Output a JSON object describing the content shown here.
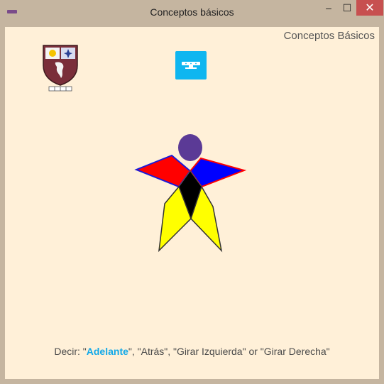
{
  "window": {
    "title": "Conceptos básicos",
    "minimize_glyph": "–",
    "maximize_glyph": "☐",
    "close_glyph": "✕"
  },
  "header": {
    "title": "Conceptos Básicos"
  },
  "instruction": {
    "prefix": "Decir: \"",
    "highlighted": "Adelante",
    "suffix": "\", \"Atrás\", \"Girar Izquierda\" or \"Girar Derecha\""
  },
  "icons": {
    "app": "app-icon",
    "crest": "school-crest-icon",
    "kinect": "kinect-sensor-icon"
  },
  "colors": {
    "background": "#fff0d8",
    "titlebar": "#c5b5a0",
    "close": "#c75050",
    "accent": "#10a8e8",
    "robot_head": "#5b3a96",
    "robot_arm_left": "#ff0000",
    "robot_arm_right": "#0000ff",
    "robot_body": "#000000",
    "robot_legs": "#ffff00"
  }
}
